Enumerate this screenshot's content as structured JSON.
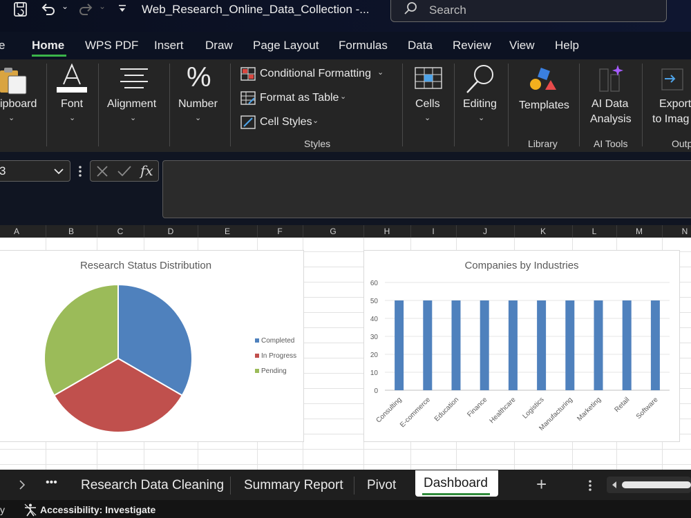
{
  "titlebar": {
    "doc_title": "Web_Research_Online_Data_Collection  -...",
    "search_placeholder": "Search"
  },
  "menu": {
    "items": [
      "e",
      "Home",
      "WPS PDF",
      "Insert",
      "Draw",
      "Page Layout",
      "Formulas",
      "Data",
      "Review",
      "View",
      "Help"
    ],
    "active": "Home"
  },
  "ribbon": {
    "clipboard": "ipboard",
    "font": "Font",
    "alignment": "Alignment",
    "number": "Number",
    "conditional_formatting": "Conditional Formatting",
    "format_as_table": "Format as Table",
    "cell_styles": "Cell Styles",
    "styles_group": "Styles",
    "cells": "Cells",
    "editing": "Editing",
    "templates": "Templates",
    "library_group": "Library",
    "ai_data_analysis_line1": "AI Data",
    "ai_data_analysis_line2": "Analysis",
    "ai_tools_group": "AI Tools",
    "export_line1": "Export",
    "export_line2": "to Imag",
    "output_group": "Outp"
  },
  "formula_bar": {
    "name_box": "3",
    "fx": "fx",
    "value": ""
  },
  "columns": [
    "A",
    "B",
    "C",
    "D",
    "E",
    "F",
    "G",
    "H",
    "I",
    "J",
    "K",
    "L",
    "M",
    "N"
  ],
  "chart_data": [
    {
      "type": "pie",
      "title": "Research Status Distribution",
      "categories": [
        "Completed",
        "In Progress",
        "Pending"
      ],
      "values": [
        1,
        1,
        1
      ],
      "colors": [
        "#4f81bd",
        "#c0504d",
        "#9bbb59"
      ],
      "legend": "right"
    },
    {
      "type": "bar",
      "title": "Companies by Industries",
      "categories": [
        "Consulting",
        "E-commerce",
        "Education",
        "Finance",
        "Healthcare",
        "Logistics",
        "Manufacturing",
        "Marketing",
        "Retail",
        "Software"
      ],
      "values": [
        50,
        50,
        50,
        50,
        50,
        50,
        50,
        50,
        50,
        50
      ],
      "ylim": [
        0,
        60
      ],
      "yticks": [
        "0",
        "10",
        "20",
        "30",
        "40",
        "50",
        "60"
      ],
      "grid": true,
      "color": "#4f81bd"
    }
  ],
  "sheet_tabs": {
    "items": [
      "Research Data Cleaning",
      "Summary Report",
      "Pivot",
      "Dashboard"
    ],
    "active": "Dashboard",
    "more": "•••",
    "add": "+"
  },
  "status": {
    "left": "y",
    "accessibility": "Accessibility: Investigate"
  }
}
